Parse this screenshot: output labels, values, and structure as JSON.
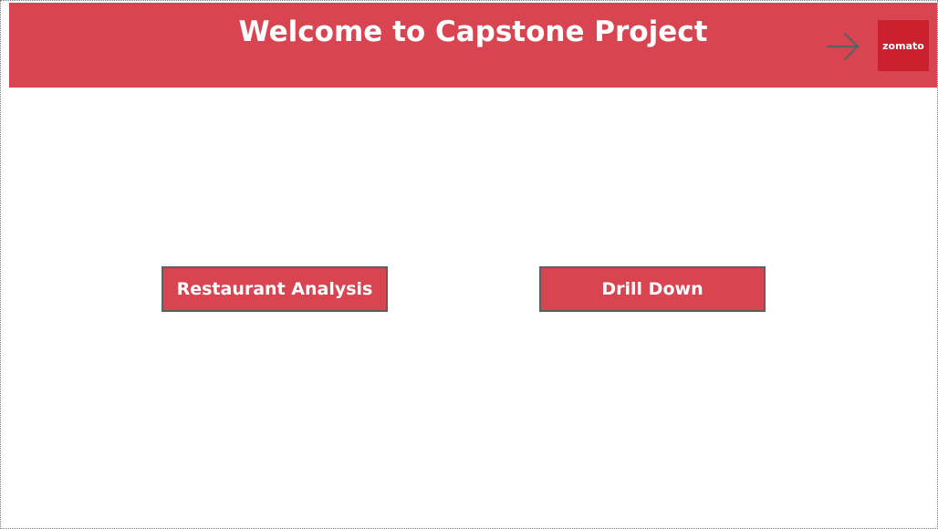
{
  "header": {
    "title": "Welcome to Capstone Project",
    "background_color": "#d84550",
    "nav_icon": "arrow-right-icon",
    "logo_text": "zomato",
    "logo_color": "#cb202d"
  },
  "buttons": {
    "restaurant_analysis": "Restaurant Analysis",
    "drill_down": "Drill Down",
    "fill_color": "#d84550",
    "border_color": "#5f5f5f"
  }
}
